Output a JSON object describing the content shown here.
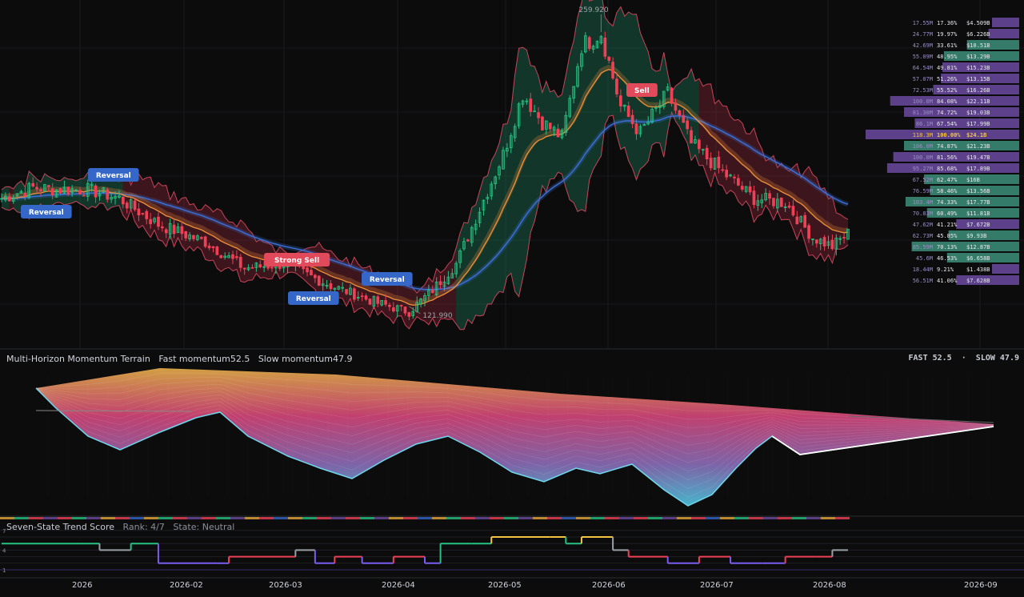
{
  "colors": {
    "bg": "#0c0c0d",
    "up": "#26c281",
    "down": "#ef4056",
    "band_up_fill": "#1b6b4e",
    "band_dn_fill": "#7a2330",
    "slow_ma": "#3b6fd6",
    "fast_ma": "#f0903a",
    "reversal_label": "#3567c8",
    "sell_label": "#e04a5a",
    "vp_green": "#3d8f7a",
    "vp_purple": "#6b4aa0",
    "highlight": "#f5c542"
  },
  "price_pane": {
    "high_label": "259.920",
    "low_label": "121.990",
    "signals": [
      {
        "text": "Reversal",
        "type": "reversal",
        "date_index": 26
      },
      {
        "text": "Reversal",
        "type": "reversal",
        "date_index": 8
      },
      {
        "text": "Strong Sell",
        "type": "sell",
        "date_index": 67
      },
      {
        "text": "Reversal",
        "type": "reversal",
        "date_index": 76
      },
      {
        "text": "Reversal",
        "type": "reversal",
        "date_index": 86
      },
      {
        "text": "Sell",
        "type": "sell",
        "date_index": 149
      }
    ]
  },
  "volume_profile": {
    "rows": [
      {
        "vol": "17.55M",
        "pct": "17.36%",
        "price": "$4.509B",
        "kind": "purple",
        "share": 0.17
      },
      {
        "vol": "24.77M",
        "pct": "19.97%",
        "price": "$6.226B",
        "kind": "purple",
        "share": 0.2
      },
      {
        "vol": "42.69M",
        "pct": "33.61%",
        "price": "$10.51B",
        "kind": "green",
        "share": 0.34
      },
      {
        "vol": "55.09M",
        "pct": "48.95%",
        "price": "$13.29B",
        "kind": "green",
        "share": 0.49
      },
      {
        "vol": "64.54M",
        "pct": "49.81%",
        "price": "$15.23B",
        "kind": "purple",
        "share": 0.5
      },
      {
        "vol": "57.07M",
        "pct": "51.26%",
        "price": "$13.15B",
        "kind": "purple",
        "share": 0.51
      },
      {
        "vol": "72.53M",
        "pct": "55.52%",
        "price": "$16.26B",
        "kind": "purple",
        "share": 0.56
      },
      {
        "vol": "100.0M",
        "pct": "84.08%",
        "price": "$22.11B",
        "kind": "purple",
        "share": 0.84
      },
      {
        "vol": "81.30M",
        "pct": "74.72%",
        "price": "$19.03B",
        "kind": "purple",
        "share": 0.75
      },
      {
        "vol": "86.1M",
        "pct": "67.54%",
        "price": "$17.99B",
        "kind": "purple",
        "share": 0.68
      },
      {
        "vol": "118.3M",
        "pct": "100.00%",
        "price": "$24.1B",
        "kind": "purple",
        "share": 1.0,
        "highlight": true
      },
      {
        "vol": "106.0M",
        "pct": "74.87%",
        "price": "$21.23B",
        "kind": "green",
        "share": 0.75
      },
      {
        "vol": "100.0M",
        "pct": "81.56%",
        "price": "$19.47B",
        "kind": "purple",
        "share": 0.82
      },
      {
        "vol": "95.27M",
        "pct": "85.68%",
        "price": "$17.89B",
        "kind": "purple",
        "share": 0.86
      },
      {
        "vol": "67.52M",
        "pct": "62.47%",
        "price": "$16B",
        "kind": "green",
        "share": 0.62
      },
      {
        "vol": "76.59M",
        "pct": "58.46%",
        "price": "$13.56B",
        "kind": "green",
        "share": 0.58
      },
      {
        "vol": "103.4M",
        "pct": "74.33%",
        "price": "$17.77B",
        "kind": "green",
        "share": 0.74
      },
      {
        "vol": "70.83M",
        "pct": "60.49%",
        "price": "$11.81B",
        "kind": "green",
        "share": 0.6
      },
      {
        "vol": "47.62M",
        "pct": "41.21%",
        "price": "$7.672B",
        "kind": "purple",
        "share": 0.41
      },
      {
        "vol": "62.73M",
        "pct": "45.85%",
        "price": "$9.93B",
        "kind": "green",
        "share": 0.46
      },
      {
        "vol": "85.59M",
        "pct": "70.13%",
        "price": "$12.87B",
        "kind": "green",
        "share": 0.7
      },
      {
        "vol": "45.6M",
        "pct": "46.53%",
        "price": "$6.658B",
        "kind": "green",
        "share": 0.47
      },
      {
        "vol": "18.44M",
        "pct": "9.21%",
        "price": "$1.438B",
        "kind": "purple",
        "share": 0.09
      },
      {
        "vol": "56.51M",
        "pct": "41.06%",
        "price": "$7.628B",
        "kind": "purple",
        "share": 0.41
      }
    ]
  },
  "momentum_pane": {
    "title": "Multi-Horizon Momentum Terrain",
    "fast_label": "Fast momentum",
    "fast_value": "52.5",
    "slow_label": "Slow momentum",
    "slow_value": "47.9",
    "corner_text": "FAST 52.5  ·  SLOW 47.9"
  },
  "trend_pane": {
    "title": "Seven-State Trend Score",
    "rank_text": "Rank: 4/7",
    "state_text": "State: Neutral",
    "axis_labels": [
      "7",
      "4",
      "1"
    ]
  },
  "time_axis": {
    "labels": [
      "2026",
      "2026-02",
      "2026-03",
      "2026-04",
      "2026-05",
      "2026-06",
      "2026-07",
      "2026-08",
      "2026-09"
    ]
  },
  "chart_data": {
    "type": "candlestick",
    "x_range": [
      "2025-12-01",
      "2026-09-15"
    ],
    "y_range": [
      115,
      268
    ],
    "anchors": [
      {
        "i": 0,
        "p": 180
      },
      {
        "i": 8,
        "p": 185
      },
      {
        "i": 14,
        "p": 184
      },
      {
        "i": 22,
        "p": 184
      },
      {
        "i": 30,
        "p": 180
      },
      {
        "i": 40,
        "p": 168
      },
      {
        "i": 52,
        "p": 160
      },
      {
        "i": 62,
        "p": 148
      },
      {
        "i": 72,
        "p": 150
      },
      {
        "i": 84,
        "p": 140
      },
      {
        "i": 96,
        "p": 132
      },
      {
        "i": 104,
        "p": 128
      },
      {
        "i": 110,
        "p": 138
      },
      {
        "i": 116,
        "p": 150
      },
      {
        "i": 122,
        "p": 175
      },
      {
        "i": 128,
        "p": 200
      },
      {
        "i": 133,
        "p": 228
      },
      {
        "i": 138,
        "p": 215
      },
      {
        "i": 143,
        "p": 208
      },
      {
        "i": 148,
        "p": 250
      },
      {
        "i": 153,
        "p": 256
      },
      {
        "i": 158,
        "p": 222
      },
      {
        "i": 163,
        "p": 210
      },
      {
        "i": 170,
        "p": 228
      },
      {
        "i": 176,
        "p": 205
      },
      {
        "i": 184,
        "p": 192
      },
      {
        "i": 192,
        "p": 180
      },
      {
        "i": 200,
        "p": 178
      },
      {
        "i": 207,
        "p": 162
      },
      {
        "i": 212,
        "p": 158
      },
      {
        "i": 216,
        "p": 164
      }
    ],
    "bars": 217,
    "trend_steps": [
      [
        0,
        5
      ],
      [
        20,
        5
      ],
      [
        25,
        4
      ],
      [
        33,
        5
      ],
      [
        40,
        2
      ],
      [
        55,
        2
      ],
      [
        58,
        3
      ],
      [
        75,
        4
      ],
      [
        80,
        2
      ],
      [
        85,
        3
      ],
      [
        92,
        2
      ],
      [
        100,
        3
      ],
      [
        108,
        2
      ],
      [
        112,
        5
      ],
      [
        120,
        5
      ],
      [
        125,
        6
      ],
      [
        140,
        6
      ],
      [
        144,
        5
      ],
      [
        148,
        6
      ],
      [
        156,
        4
      ],
      [
        160,
        3
      ],
      [
        170,
        2
      ],
      [
        178,
        3
      ],
      [
        186,
        2
      ],
      [
        194,
        2
      ],
      [
        200,
        3
      ],
      [
        208,
        3
      ],
      [
        212,
        4
      ]
    ]
  }
}
